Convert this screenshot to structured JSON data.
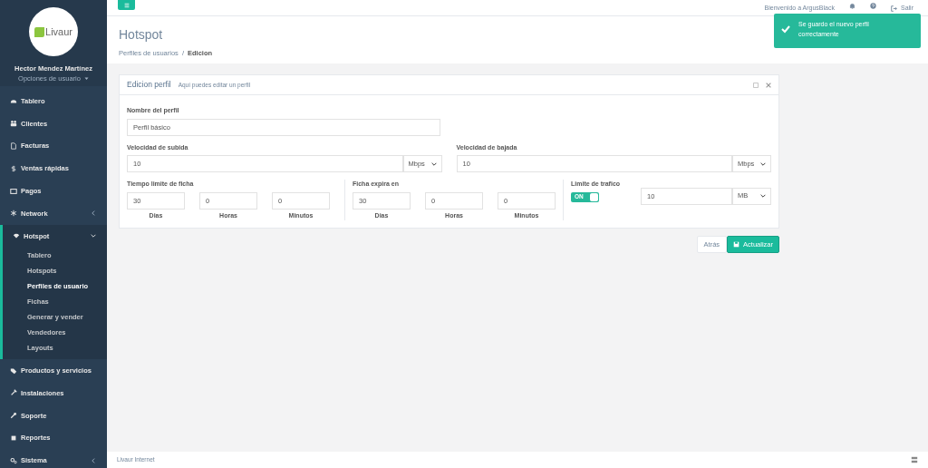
{
  "sidebar": {
    "logo": "Livaur",
    "user_name": "Hector Mendez Martínez",
    "user_options": "Opciones de usuario",
    "items": [
      {
        "label": "Tablero",
        "submenu": false,
        "expanded": false
      },
      {
        "label": "Clientes",
        "submenu": false,
        "expanded": false
      },
      {
        "label": "Facturas",
        "submenu": false,
        "expanded": false
      },
      {
        "label": "Ventas rápidas",
        "submenu": false,
        "expanded": false
      },
      {
        "label": "Pagos",
        "submenu": false,
        "expanded": false
      },
      {
        "label": "Network",
        "submenu": true,
        "expanded": false
      },
      {
        "label": "Hotspot",
        "submenu": true,
        "expanded": true,
        "children": [
          {
            "label": "Tablero",
            "selected": false
          },
          {
            "label": "Hotspots",
            "selected": false
          },
          {
            "label": "Perfiles de usuario",
            "selected": true
          },
          {
            "label": "Fichas",
            "selected": false
          },
          {
            "label": "Generar y vender",
            "selected": false
          },
          {
            "label": "Vendedores",
            "selected": false
          },
          {
            "label": "Layouts",
            "selected": false
          }
        ]
      },
      {
        "label": "Productos y servicios",
        "submenu": false,
        "expanded": false
      },
      {
        "label": "Instalaciones",
        "submenu": false,
        "expanded": false
      },
      {
        "label": "Soporte",
        "submenu": false,
        "expanded": false
      },
      {
        "label": "Reportes",
        "submenu": false,
        "expanded": false
      },
      {
        "label": "Sistema",
        "submenu": true,
        "expanded": false
      }
    ]
  },
  "topbar": {
    "welcome": "Bienvenido a ArgusBlack",
    "logout": "Salir"
  },
  "toast": {
    "message": "Se guardo el nuevo perfil correctamente"
  },
  "header": {
    "title": "Hotspot",
    "breadcrumb_separator": "/",
    "breadcrumb": [
      {
        "label": "Perfiles de usuarios",
        "selected": false
      },
      {
        "label": "Edicion",
        "selected": true
      }
    ]
  },
  "panel": {
    "title": "Edicion perfil",
    "subtitle": "Aquí puedes editar un perfil",
    "profile_name": {
      "label": "Nombre del perfil",
      "value": "Perfil básico"
    },
    "upload": {
      "label": "Velocidad de subida",
      "value": "10",
      "unit": "Mbps"
    },
    "download": {
      "label": "Velocidad de bajada",
      "value": "10",
      "unit": "Mbps"
    },
    "time_limit": {
      "label": "Tiempo limite de ficha",
      "fields": [
        {
          "value": "30",
          "caption": "Dias"
        },
        {
          "value": "0",
          "caption": "Horas"
        },
        {
          "value": "0",
          "caption": "Minutos"
        }
      ]
    },
    "expires": {
      "label": "Ficha expira en",
      "fields": [
        {
          "value": "30",
          "caption": "Dias"
        },
        {
          "value": "0",
          "caption": "Horas"
        },
        {
          "value": "0",
          "caption": "Minutos"
        }
      ]
    },
    "traffic": {
      "label": "Limite de trafico",
      "toggle_text": "ON",
      "on": true,
      "value": "10",
      "unit": "MB"
    }
  },
  "buttons": {
    "back": "Atrás",
    "update": "Actualizar"
  },
  "footer": {
    "text": "Livaur Internet"
  }
}
